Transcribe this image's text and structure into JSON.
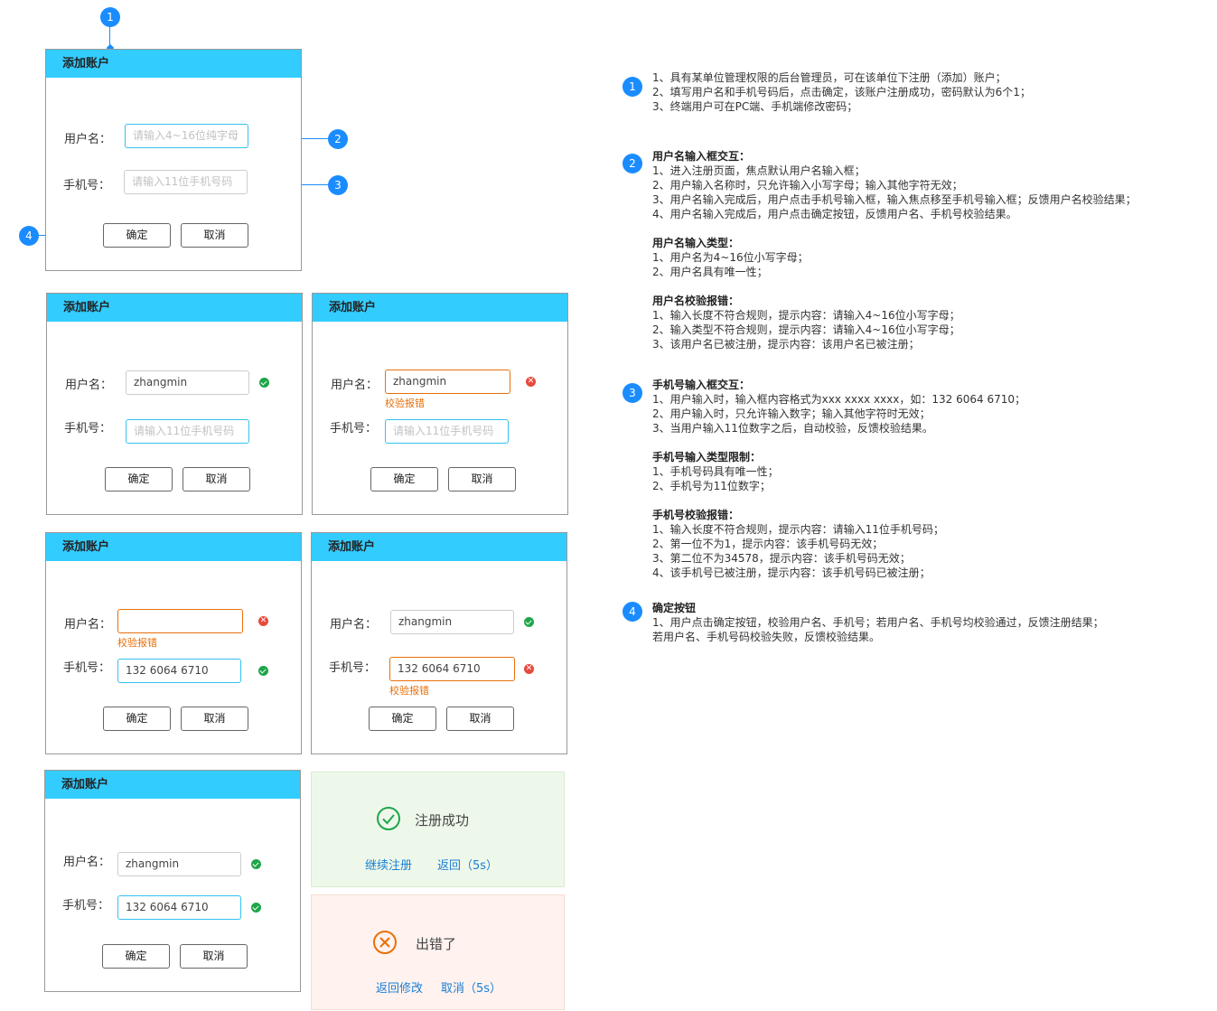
{
  "dialog": {
    "title": "添加账户",
    "username_label": "用户名：",
    "phone_label": "手机号：",
    "username_placeholder": "请输入4~16位纯字母",
    "phone_placeholder": "请输入11位手机号码",
    "confirm": "确定",
    "cancel": "取消"
  },
  "values": {
    "username": "zhangmin",
    "phone": "132 6064 6710",
    "error_hint": "校验报错"
  },
  "badges": [
    "1",
    "2",
    "3",
    "4"
  ],
  "success": {
    "title": "注册成功",
    "continue": "继续注册",
    "back": "返回（5s）"
  },
  "failure": {
    "title": "出错了",
    "back_edit": "返回修改",
    "cancel": "取消（5s）"
  },
  "notes": {
    "s1": [
      "1、具有某单位管理权限的后台管理员，可在该单位下注册（添加）账户；",
      "2、填写用户名和手机号码后，点击确定，该账户注册成功，密码默认为6个1；",
      "3、终端用户可在PC端、手机端修改密码；"
    ],
    "s2_h1": "用户名输入框交互：",
    "s2_a": [
      "1、进入注册页面，焦点默认用户名输入框；",
      "2、用户输入名称时，只允许输入小写字母；输入其他字符无效；",
      "3、用户名输入完成后，用户点击手机号输入框，输入焦点移至手机号输入框；反馈用户名校验结果；",
      "4、用户名输入完成后，用户点击确定按钮，反馈用户名、手机号校验结果。"
    ],
    "s2_h2": "用户名输入类型：",
    "s2_b": [
      "1、用户名为4~16位小写字母；",
      "2、用户名具有唯一性；"
    ],
    "s2_h3": "用户名校验报错：",
    "s2_c": [
      "1、输入长度不符合规则，提示内容：请输入4~16位小写字母；",
      "2、输入类型不符合规则，提示内容：请输入4~16位小写字母；",
      "3、该用户名已被注册，提示内容：该用户名已被注册；"
    ],
    "s3_h1": "手机号输入框交互：",
    "s3_a": [
      "1、用户输入时，输入框内容格式为xxx xxxx xxxx，如：132 6064 6710；",
      "2、用户输入时，只允许输入数字；输入其他字符时无效；",
      "3、当用户输入11位数字之后，自动校验，反馈校验结果。"
    ],
    "s3_h2": "手机号输入类型限制：",
    "s3_b": [
      "1、手机号码具有唯一性；",
      "2、手机号为11位数字；"
    ],
    "s3_h3": "手机号校验报错：",
    "s3_c": [
      "1、输入长度不符合规则，提示内容：请输入11位手机号码；",
      "2、第一位不为1，提示内容：该手机号码无效；",
      "3、第二位不为34578，提示内容：该手机号码无效；",
      "4、该手机号已被注册，提示内容：该手机号码已被注册；"
    ],
    "s4_h1": "确定按钮",
    "s4_a": [
      "1、用户点击确定按钮，校验用户名、手机号；若用户名、手机号均校验通过，反馈注册结果；",
      "若用户名、手机号码校验失败，反馈校验结果。"
    ]
  }
}
